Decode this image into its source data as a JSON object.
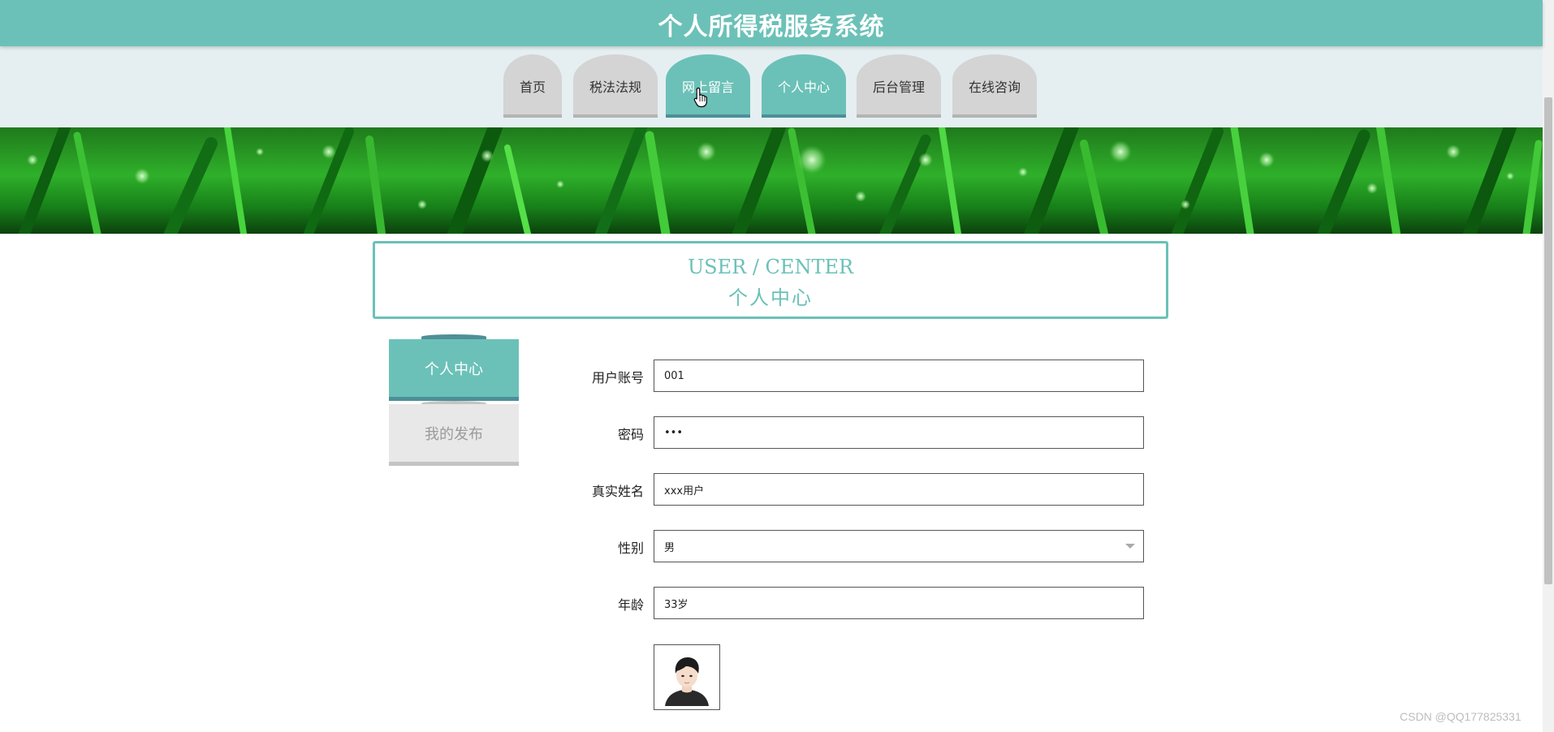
{
  "header": {
    "title": "个人所得税服务系统"
  },
  "nav": {
    "tabs": [
      {
        "label": "首页",
        "active": false
      },
      {
        "label": "税法法规",
        "active": false
      },
      {
        "label": "网上留言",
        "active": true
      },
      {
        "label": "个人中心",
        "active": true
      },
      {
        "label": "后台管理",
        "active": false
      },
      {
        "label": "在线咨询",
        "active": false
      }
    ]
  },
  "section": {
    "title_en": "USER / CENTER",
    "title_cn": "个人中心"
  },
  "side_menu": {
    "items": [
      {
        "label": "个人中心",
        "active": true
      },
      {
        "label": "我的发布",
        "active": false
      }
    ]
  },
  "form": {
    "account": {
      "label": "用户账号",
      "value": "001"
    },
    "password": {
      "label": "密码",
      "value": "•••"
    },
    "real_name": {
      "label": "真实姓名",
      "value": "xxx用户"
    },
    "gender": {
      "label": "性别",
      "value": "男"
    },
    "age": {
      "label": "年龄",
      "value": "33岁"
    }
  },
  "watermark": "CSDN @QQ177825331",
  "colors": {
    "primary": "#6bc1b8",
    "primary_dark": "#4e8f98",
    "tab_inactive": "#d4d4d4",
    "nav_background": "#e5eff1",
    "banner_green": "#2fb02a"
  },
  "icons": {
    "cursor": "hand-pointer-icon",
    "select_arrow": "caret-down-icon",
    "avatar": "user-avatar-image"
  }
}
